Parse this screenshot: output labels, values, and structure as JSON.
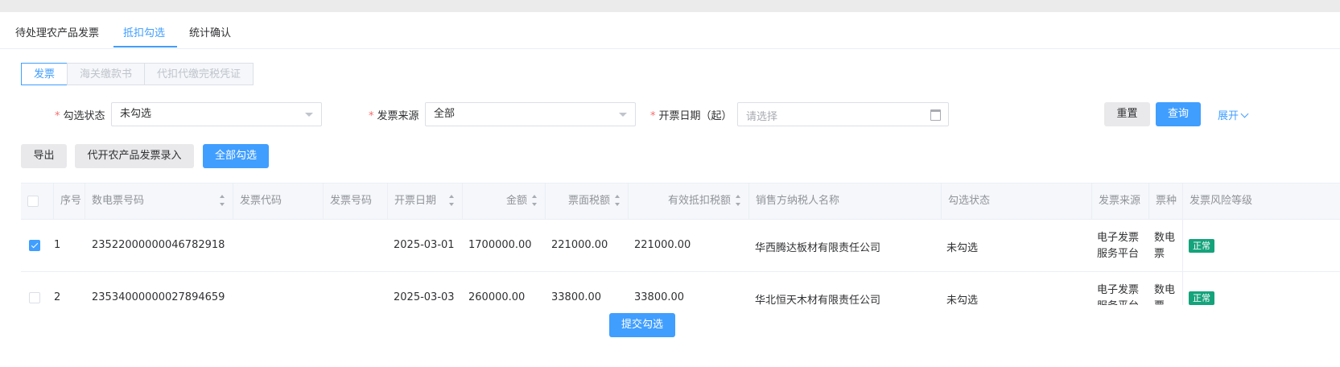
{
  "tabs": [
    {
      "label": "待处理农产品发票"
    },
    {
      "label": "抵扣勾选"
    },
    {
      "label": "统计确认"
    }
  ],
  "doc_types": [
    "发票",
    "海关缴款书",
    "代扣代缴完税凭证"
  ],
  "filters": {
    "check_status": {
      "label": "勾选状态",
      "value": "未勾选"
    },
    "invoice_source": {
      "label": "发票来源",
      "value": "全部"
    },
    "issue_date_start": {
      "label": "开票日期（起）",
      "placeholder": "请选择"
    }
  },
  "buttons": {
    "reset": "重置",
    "query": "查询",
    "expand": "展开",
    "export": "导出",
    "agent_entry": "代开农产品发票录入",
    "select_all": "全部勾选",
    "submit": "提交勾选"
  },
  "table": {
    "columns": [
      "序号",
      "数电票号码",
      "发票代码",
      "发票号码",
      "开票日期",
      "金额",
      "票面税额",
      "有效抵扣税额",
      "销售方纳税人名称",
      "勾选状态",
      "发票来源",
      "票种",
      "发票风险等级"
    ],
    "rows": [
      {
        "checked": true,
        "no": "1",
        "e_invoice_no": "23522000000046782918",
        "date": "2025-03-01",
        "amount": "1700000.00",
        "tax": "221000.00",
        "deductible": "221000.00",
        "seller": "华西腾达板材有限责任公司",
        "status": "未勾选",
        "source": "电子发票服务平台",
        "type": "数电票（发票）",
        "risk": "正常"
      },
      {
        "checked": false,
        "no": "2",
        "e_invoice_no": "23534000000027894659",
        "date": "2025-03-03",
        "amount": "260000.00",
        "tax": "33800.00",
        "deductible": "33800.00",
        "seller": "华北恒天木材有限责任公司",
        "status": "未勾选",
        "source": "电子发票服务平台",
        "type": "数电票（发票）",
        "risk": "正常"
      }
    ]
  },
  "colors": {
    "accent": "#409eff",
    "required": "#f56c6c",
    "risk_normal": "#15a37b"
  }
}
